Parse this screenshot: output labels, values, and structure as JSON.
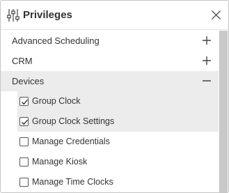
{
  "header": {
    "title": "Privileges",
    "filter_icon": "sliders-icon",
    "close_icon": "close-icon"
  },
  "groups": [
    {
      "label": "Advanced Scheduling",
      "state": "collapsed",
      "toggle_icon": "plus-icon"
    },
    {
      "label": "CRM",
      "state": "collapsed",
      "toggle_icon": "plus-icon"
    },
    {
      "label": "Devices",
      "state": "expanded",
      "toggle_icon": "minus-icon"
    }
  ],
  "devices_items": [
    {
      "label": "Group Clock",
      "checked": true
    },
    {
      "label": "Group Clock Settings",
      "checked": true
    },
    {
      "label": "Manage Credentials",
      "checked": false
    },
    {
      "label": "Manage Kiosk",
      "checked": false
    },
    {
      "label": "Manage Time Clocks",
      "checked": false
    }
  ],
  "colors": {
    "highlight": "#ececec",
    "text": "#333333",
    "border": "#c4c4c4"
  }
}
